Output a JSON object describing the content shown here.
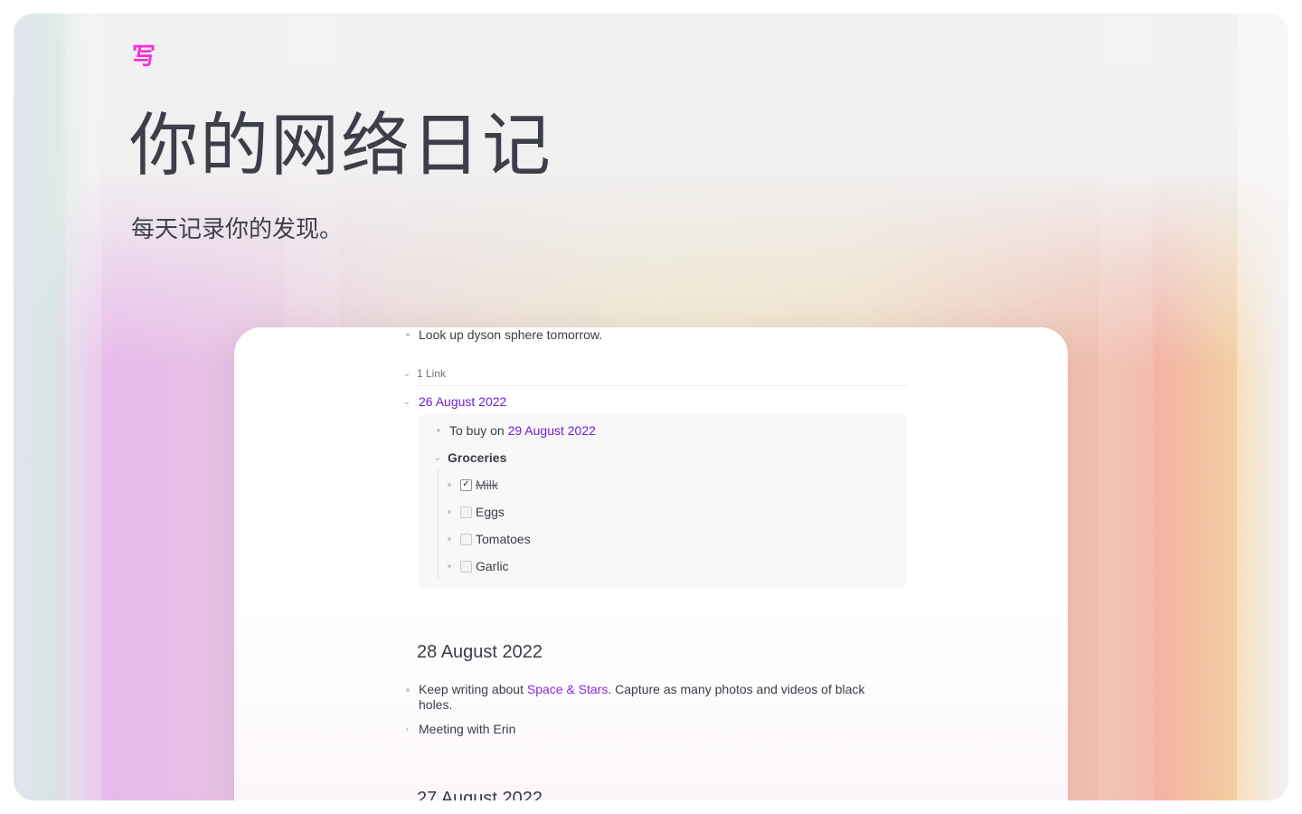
{
  "app": {
    "logo_glyph": "写",
    "accent_color": "#f52fd8",
    "link_color": "#6b1fd6"
  },
  "hero": {
    "title": "你的网络日记",
    "subtitle": "每天记录你的发现。"
  },
  "journal": {
    "first_note": "Look up dyson sphere tomorrow.",
    "links_toggle": "1 Link",
    "linked_date": "26 August 2022",
    "to_buy_prefix": "To buy on",
    "to_buy_date": "29 August 2022",
    "groceries_label": "Groceries",
    "groceries": [
      {
        "label": "Milk",
        "checked": true
      },
      {
        "label": "Eggs",
        "checked": false
      },
      {
        "label": "Tomatoes",
        "checked": false
      },
      {
        "label": "Garlic",
        "checked": false
      }
    ],
    "entry_date": "28 August 2022",
    "entry_text_before": "Keep writing about",
    "entry_link": "Space & Stars",
    "entry_text_after": ". Capture as many photos and videos of black",
    "entry_text_wrap": "holes.",
    "meeting_item": "Meeting with Erin",
    "next_date_partial": "27 August 2022"
  }
}
